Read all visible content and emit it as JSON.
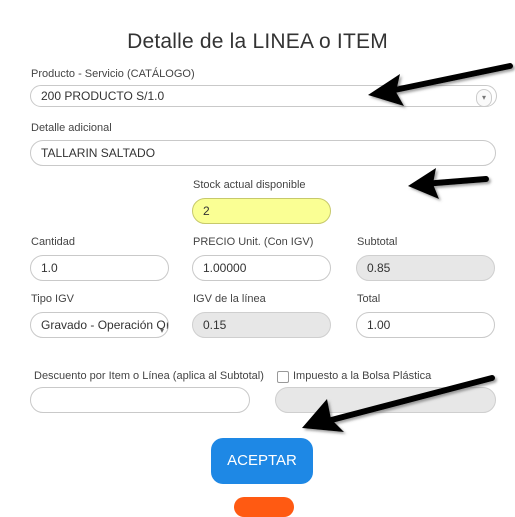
{
  "dialog": {
    "title": "Detalle de la LINEA o ITEM"
  },
  "producto": {
    "label": "Producto - Servicio (CATÁLOGO)",
    "value": "200 PRODUCTO S/1.0"
  },
  "detalle": {
    "label": "Detalle adicional",
    "value": "TALLARIN SALTADO"
  },
  "stock": {
    "label": "Stock actual disponible",
    "value": "2"
  },
  "cantidad": {
    "label": "Cantidad",
    "value": "1.0"
  },
  "precio": {
    "label": "PRECIO Unit. (Con IGV)",
    "value": "1.00000"
  },
  "subtotal": {
    "label": "Subtotal",
    "value": "0.85"
  },
  "tipo_igv": {
    "label": "Tipo IGV",
    "value": "Gravado - Operación Oı"
  },
  "igv_linea": {
    "label": "IGV de la línea",
    "value": "0.15"
  },
  "total": {
    "label": "Total",
    "value": "1.00"
  },
  "descuento": {
    "label": "Descuento por Item o Línea (aplica al Subtotal)",
    "value": ""
  },
  "bolsa": {
    "label": "Impuesto a la Bolsa Plástica",
    "checked": false,
    "value": ""
  },
  "buttons": {
    "accept": "ACEPTAR"
  },
  "colors": {
    "accept": "#1e88e5",
    "orange": "#ff5a12",
    "stock_highlight": "#faff94",
    "readonly_field": "#e7e7e7"
  }
}
